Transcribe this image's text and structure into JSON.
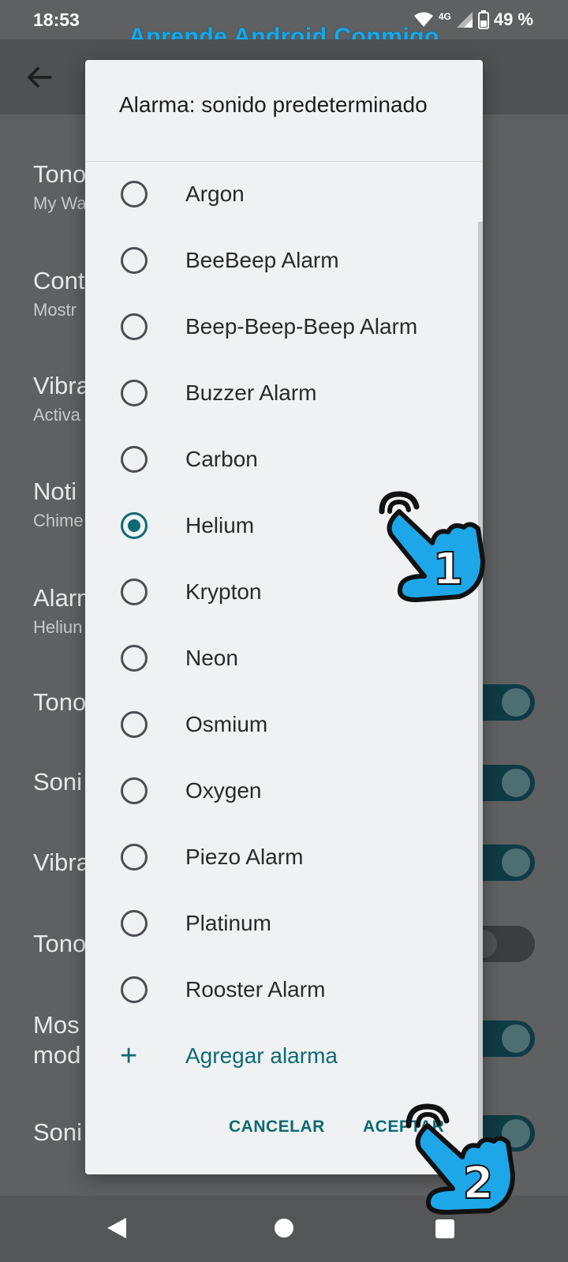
{
  "status_bar": {
    "time": "18:53",
    "network": "4G",
    "battery": "49 %"
  },
  "watermark": "Aprende Android Conmigo",
  "background_settings": [
    {
      "title": "Tono",
      "subtitle": "My Wa"
    },
    {
      "title": "Cont",
      "subtitle": "Mostr"
    },
    {
      "title": "Vibra",
      "subtitle": "Activa"
    },
    {
      "title": "Noti",
      "subtitle": "Chime"
    },
    {
      "title": "Alarm",
      "subtitle": "Heliun"
    },
    {
      "title": "Tono",
      "subtitle": ""
    },
    {
      "title": "Soni",
      "subtitle": ""
    },
    {
      "title": "Vibra",
      "subtitle": ""
    },
    {
      "title": "Tono",
      "subtitle": ""
    },
    {
      "title": "Mos",
      "subtitle": "mod"
    },
    {
      "title": "Soni",
      "subtitle": ""
    }
  ],
  "dialog": {
    "title": "Alarma: sonido predeterminado",
    "options": [
      {
        "label": "Argon",
        "checked": false
      },
      {
        "label": "BeeBeep Alarm",
        "checked": false
      },
      {
        "label": "Beep-Beep-Beep Alarm",
        "checked": false
      },
      {
        "label": "Buzzer Alarm",
        "checked": false
      },
      {
        "label": "Carbon",
        "checked": false
      },
      {
        "label": "Helium",
        "checked": true
      },
      {
        "label": "Krypton",
        "checked": false
      },
      {
        "label": "Neon",
        "checked": false
      },
      {
        "label": "Osmium",
        "checked": false
      },
      {
        "label": "Oxygen",
        "checked": false
      },
      {
        "label": "Piezo Alarm",
        "checked": false
      },
      {
        "label": "Platinum",
        "checked": false
      },
      {
        "label": "Rooster Alarm",
        "checked": false
      }
    ],
    "add_label": "Agregar alarma",
    "cancel_label": "CANCELAR",
    "ok_label": "ACEPTAR"
  },
  "annotations": {
    "step1": "1",
    "step2": "2"
  },
  "colors": {
    "accent": "#0d6a74",
    "watermark": "#19a6e6",
    "hand": "#1ea7e8"
  }
}
